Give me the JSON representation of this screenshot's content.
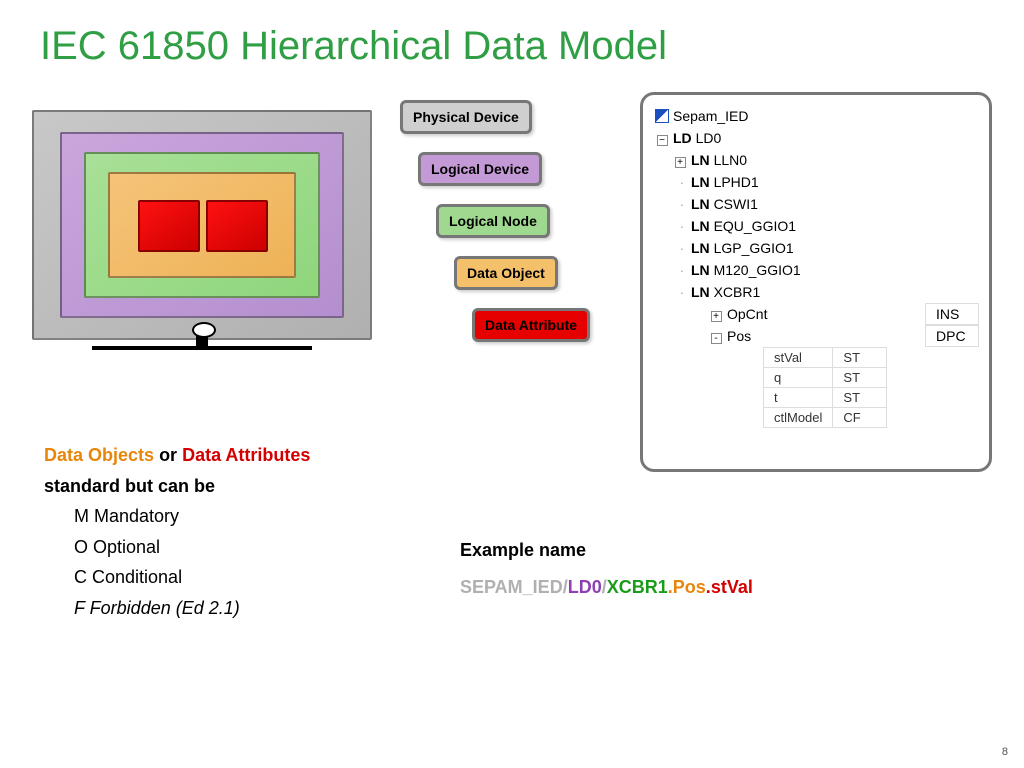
{
  "title": "IEC 61850 Hierarchical Data Model",
  "page_number": "8",
  "legend": {
    "physical": "Physical Device",
    "logical": "Logical Device",
    "node": "Logical Node",
    "object": "Data Object",
    "attr": "Data Attribute"
  },
  "legend_text": {
    "line1_a": "Data Objects",
    "line1_b": " or ",
    "line1_c": "Data Attributes",
    "line2": "standard but can be",
    "m": "M  Mandatory",
    "o": "O  Optional",
    "c": "C  Conditional",
    "f": "F   Forbidden (Ed 2.1)"
  },
  "tree": {
    "ied": "Sepam_IED",
    "ld_tag": "LD",
    "ld_name": "LD0",
    "ln_tag": "LN",
    "lns": [
      "LLN0",
      "LPHD1",
      "CSWI1",
      "EQU_GGIO1",
      "LGP_GGIO1",
      "M120_GGIO1",
      "XCBR1"
    ],
    "objects": [
      {
        "name": "OpCnt",
        "expand": "+",
        "type": "INS"
      },
      {
        "name": "Pos",
        "expand": "-",
        "type": "DPC"
      }
    ],
    "attrs": [
      {
        "name": "stVal",
        "fc": "ST"
      },
      {
        "name": "q",
        "fc": "ST"
      },
      {
        "name": "t",
        "fc": "ST"
      },
      {
        "name": "ctlModel",
        "fc": "CF"
      }
    ]
  },
  "example": {
    "label": "Example name",
    "ied": "SEPAM_IED",
    "sep1": "/",
    "ld": "LD0",
    "sep2": "/",
    "ln": "XCBR1",
    "sep3": ".",
    "obj": "Pos",
    "sep4": ".",
    "attr": "stVal"
  }
}
